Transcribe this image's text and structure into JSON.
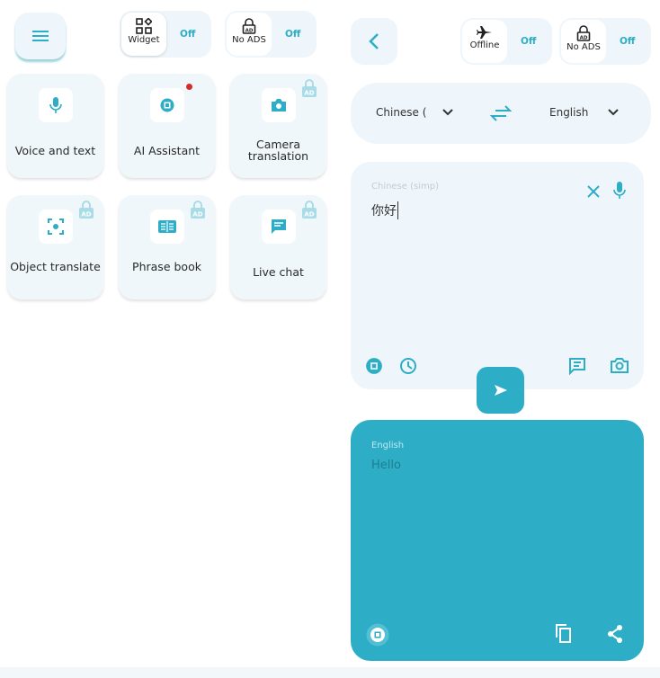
{
  "colors": {
    "accent": "#2daec6",
    "panel": "#eef6fb"
  },
  "left": {
    "menu_icon": "hamburger-icon",
    "widget_toggle": {
      "label": "Widget",
      "state": "Off"
    },
    "noads_toggle": {
      "label": "No ADS",
      "state": "Off"
    },
    "features": [
      {
        "label": "Voice and text",
        "icon": "mic-icon",
        "locked": false
      },
      {
        "label": "AI Assistant",
        "icon": "ai-chip-icon",
        "locked": false,
        "badge": true
      },
      {
        "label": "Camera translation",
        "icon": "camera-icon",
        "locked": true
      },
      {
        "label": "Object translate",
        "icon": "object-scan-icon",
        "locked": true
      },
      {
        "label": "Phrase book",
        "icon": "book-icon",
        "locked": true
      },
      {
        "label": "Live chat",
        "icon": "chat-icon",
        "locked": true
      }
    ]
  },
  "right": {
    "offline_toggle": {
      "label": "Offline",
      "state": "Off"
    },
    "noads_toggle": {
      "label": "No ADS",
      "state": "Off"
    },
    "source_lang": "Chinese (",
    "target_lang": "English",
    "input": {
      "label": "Chinese (simp)",
      "text": "你好"
    },
    "output": {
      "label": "English",
      "text": "Hello"
    }
  }
}
